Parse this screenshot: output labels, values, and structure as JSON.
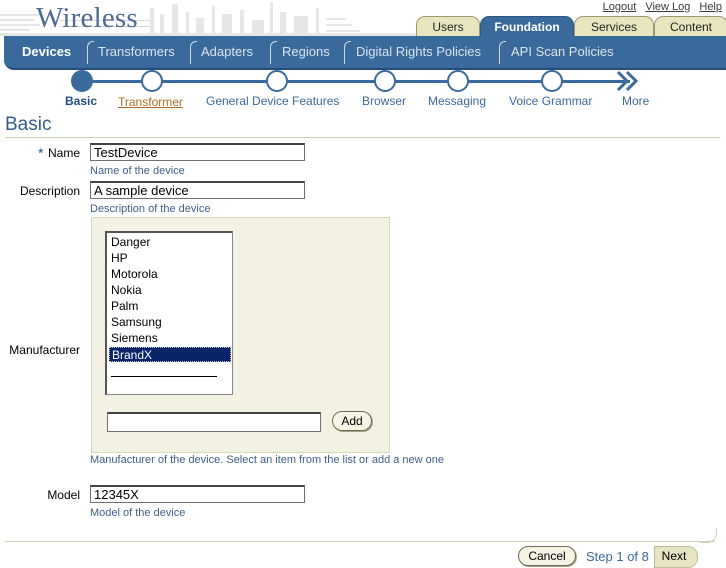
{
  "app": {
    "title": "Wireless"
  },
  "global_links": [
    "Logout",
    "View Log",
    "Help"
  ],
  "tabs": [
    {
      "label": "Users",
      "active": false
    },
    {
      "label": "Foundation",
      "active": true
    },
    {
      "label": "Services",
      "active": false
    },
    {
      "label": "Content",
      "active": false
    }
  ],
  "subtabs": [
    {
      "label": "Devices",
      "active": true
    },
    {
      "label": "Transformers",
      "active": false
    },
    {
      "label": "Adapters",
      "active": false
    },
    {
      "label": "Regions",
      "active": false
    },
    {
      "label": "Digital Rights Policies",
      "active": false
    },
    {
      "label": "API Scan Policies",
      "active": false
    }
  ],
  "train": {
    "steps": [
      "Basic",
      "Transformer",
      "General Device Features",
      "Browser",
      "Messaging",
      "Voice Grammar"
    ],
    "current": "Basic",
    "more_label": "More"
  },
  "page": {
    "title": "Basic"
  },
  "form": {
    "required_marker": "*",
    "name": {
      "label": "Name",
      "value": "TestDevice",
      "hint": "Name of the device"
    },
    "description": {
      "label": "Description",
      "value": "A sample device",
      "hint": "Description of the device"
    },
    "manufacturer": {
      "label": "Manufacturer",
      "options": [
        "Danger",
        "HP",
        "Motorola",
        "Nokia",
        "Palm",
        "Samsung",
        "Siemens",
        "BrandX"
      ],
      "selected": "BrandX",
      "new_value": "",
      "add_label": "Add",
      "hint": "Manufacturer of the device. Select an item from the list or add a new one"
    },
    "model": {
      "label": "Model",
      "value": "12345X",
      "hint": "Model of the device"
    }
  },
  "footer": {
    "cancel_label": "Cancel",
    "step_text": "Step 1 of 8",
    "next_label": "Next"
  },
  "colors": {
    "brand": "#3a6a9b",
    "tab_inactive": "#e8e6c1",
    "panel": "#f2f1e2",
    "selection": "#0a246a"
  }
}
